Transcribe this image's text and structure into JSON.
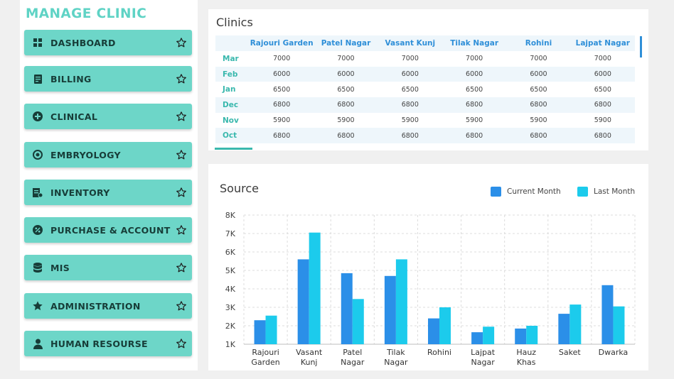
{
  "sidebar": {
    "title": "MANAGE CLINIC",
    "items": [
      {
        "label": "DASHBOARD",
        "icon": "grid-icon"
      },
      {
        "label": "BILLING",
        "icon": "receipt-icon"
      },
      {
        "label": "CLINICAL",
        "icon": "plus-circle-icon"
      },
      {
        "label": "EMBRYOLOGY",
        "icon": "cell-icon"
      },
      {
        "label": "INVENTORY",
        "icon": "inventory-icon"
      },
      {
        "label": "PURCHASE & ACCOUNT",
        "icon": "percent-badge-icon"
      },
      {
        "label": "MIS",
        "icon": "database-icon"
      },
      {
        "label": "ADMINISTRATION",
        "icon": "star-filled-icon"
      },
      {
        "label": "HUMAN RESOURSE",
        "icon": "user-icon"
      }
    ]
  },
  "clinics": {
    "title": "Clinics",
    "columns": [
      "",
      "Rajouri Garden",
      "Patel Nagar",
      "Vasant Kunj",
      "Tilak Nagar",
      "Rohini",
      "Lajpat Nagar"
    ],
    "rows": [
      {
        "month": "Mar",
        "values": [
          "7000",
          "7000",
          "7000",
          "7000",
          "7000",
          "7000"
        ]
      },
      {
        "month": "Feb",
        "values": [
          "6000",
          "6000",
          "6000",
          "6000",
          "6000",
          "6000"
        ]
      },
      {
        "month": "Jan",
        "values": [
          "6500",
          "6500",
          "6500",
          "6500",
          "6500",
          "6500"
        ]
      },
      {
        "month": "Dec",
        "values": [
          "6800",
          "6800",
          "6800",
          "6800",
          "6800",
          "6800"
        ]
      },
      {
        "month": "Nov",
        "values": [
          "5900",
          "5900",
          "5900",
          "5900",
          "5900",
          "5900"
        ]
      },
      {
        "month": "Oct",
        "values": [
          "6800",
          "6800",
          "6800",
          "6800",
          "6800",
          "6800"
        ]
      }
    ]
  },
  "source": {
    "title": "Source"
  },
  "colors": {
    "accent": "#6dd6c8",
    "current": "#2b8fe8",
    "last": "#1ccbec"
  },
  "chart_data": {
    "type": "bar",
    "title": "Source",
    "categories": [
      [
        "Rajouri",
        "Garden"
      ],
      [
        "Vasant",
        "Kunj"
      ],
      [
        "Patel",
        "Nagar"
      ],
      [
        "Tilak",
        "Nagar"
      ],
      [
        "Rohini"
      ],
      [
        "Lajpat",
        "Nagar"
      ],
      [
        "Hauz",
        "Khas"
      ],
      [
        "Saket"
      ],
      [
        "Dwarka"
      ]
    ],
    "series": [
      {
        "name": "Current Month",
        "values": [
          2300,
          5600,
          4850,
          4700,
          2400,
          1650,
          1850,
          2650,
          4200
        ]
      },
      {
        "name": "Last Month",
        "values": [
          2550,
          7050,
          3450,
          5600,
          3000,
          1950,
          2000,
          3150,
          3050
        ]
      }
    ],
    "yticks": [
      "1K",
      "2K",
      "3K",
      "4K",
      "5K",
      "6K",
      "7K",
      "8K"
    ],
    "ylim": [
      1000,
      8000
    ],
    "grid": true,
    "legend": "top-right"
  }
}
